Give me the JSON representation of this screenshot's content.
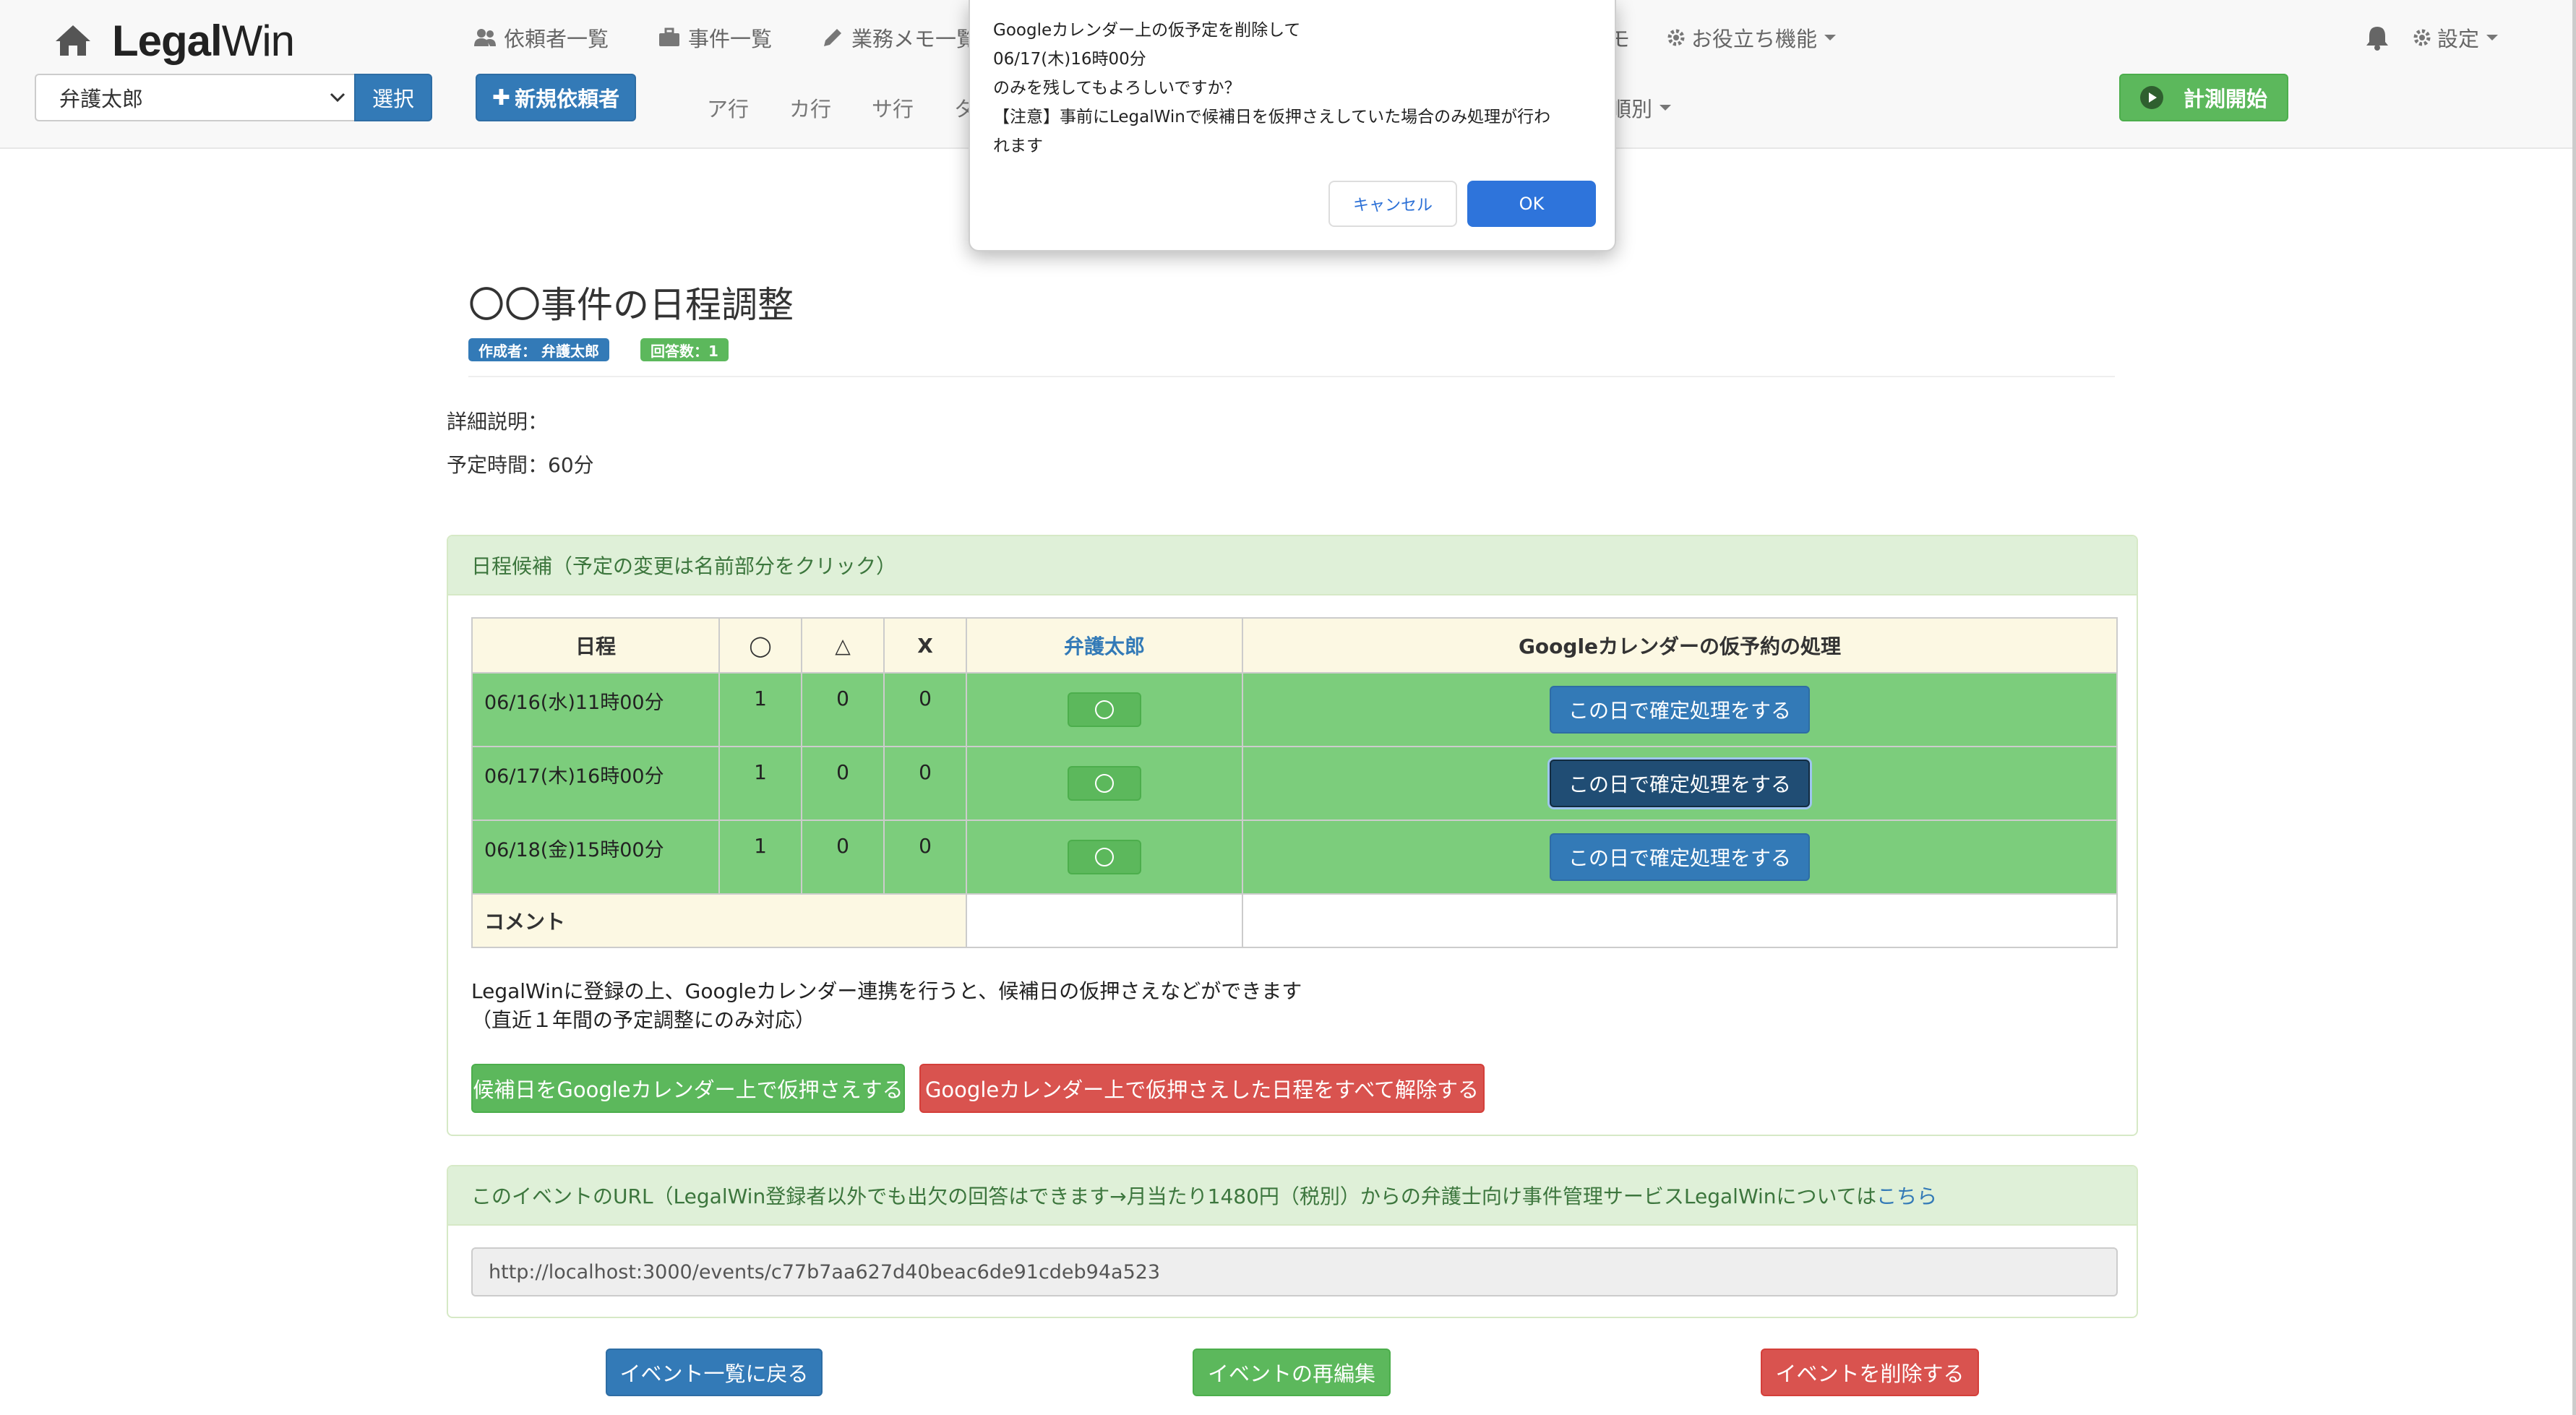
{
  "brand": {
    "name_bold": "Legal",
    "name_light": "Win"
  },
  "nav": {
    "clients": "依頼者一覧",
    "cases": "事件一覧",
    "memos": "業務メモ一覧",
    "memo_tail": "モ",
    "useful": "お役立ち機能",
    "settings": "設定",
    "kana_tail": "順別"
  },
  "client_select": {
    "value": "弁護太郎",
    "select_label": "選択"
  },
  "new_client_label": "新規依頼者",
  "kana": [
    "ア行",
    "カ行",
    "サ行",
    "タ"
  ],
  "timer_label": "計測開始",
  "event": {
    "title": "〇〇事件の日程調整",
    "author_badge": "作成者： 弁護太郎",
    "answers_badge": "回答数：1",
    "description": "詳細説明：",
    "duration": "予定時間：60分"
  },
  "schedule": {
    "heading": "日程候補（予定の変更は名前部分をクリック）",
    "headers": {
      "date": "日程",
      "ok": "◯",
      "maybe": "△",
      "ng": "X",
      "member": "弁護太郎",
      "action": "Googleカレンダーの仮予約の処理"
    },
    "rows": [
      {
        "date": "06/16(水)11時00分",
        "ok": "1",
        "maybe": "0",
        "ng": "0",
        "action": "この日で確定処理をする"
      },
      {
        "date": "06/17(木)16時00分",
        "ok": "1",
        "maybe": "0",
        "ng": "0",
        "action": "この日で確定処理をする"
      },
      {
        "date": "06/18(金)15時00分",
        "ok": "1",
        "maybe": "0",
        "ng": "0",
        "action": "この日で確定処理をする"
      }
    ],
    "comment_label": "コメント",
    "note_line1": "LegalWinに登録の上、Googleカレンダー連携を行うと、候補日の仮押さえなどができます",
    "note_line2": "（直近１年間の予定調整にのみ対応）",
    "hold_button": "候補日をGoogleカレンダー上で仮押さえする",
    "release_button": "Googleカレンダー上で仮押さえした日程をすべて解除する"
  },
  "url_panel": {
    "heading": "このイベントのURL（LegalWin登録者以外でも出欠の回答はできます→月当たり1480円（税別）からの弁護士向け事件管理サービスLegalWinについては",
    "heading_link": "こちら",
    "url": "http://localhost:3000/events/c77b7aa627d40beac6de91cdeb94a523"
  },
  "bottom": {
    "back": "イベント一覧に戻る",
    "edit": "イベントの再編集",
    "delete": "イベントを削除する"
  },
  "dialog": {
    "line1": "Googleカレンダー上の仮予定を削除して",
    "line2": "06/17(木)16時00分",
    "line3": "のみを残してもよろしいですか？",
    "line4": "【注意】事前にLegalWinで候補日を仮押さえしていた場合のみ処理が行わ",
    "line5": "れます",
    "cancel": "キャンセル",
    "ok": "OK"
  },
  "colors": {
    "primary": "#337ab7",
    "success": "#5cb85c",
    "danger": "#d9534f",
    "candidate_row": "#7ccd7c",
    "dialog_ok": "#2e74db"
  }
}
